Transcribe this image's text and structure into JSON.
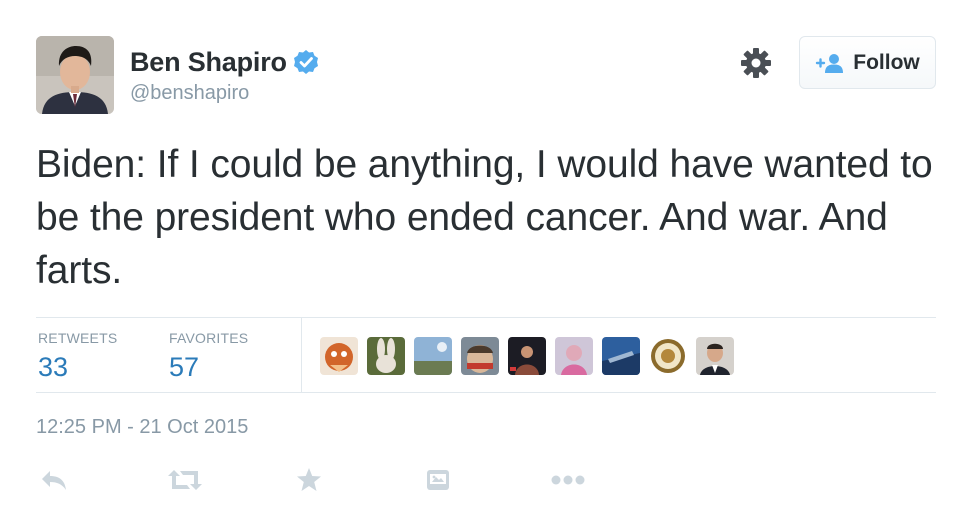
{
  "user": {
    "display_name": "Ben Shapiro",
    "handle": "@benshapiro",
    "verified": true
  },
  "header": {
    "follow_label": "Follow"
  },
  "tweet": {
    "text": "Biden: If I could be anything, I would have wanted to be the president who ended cancer. And war. And farts.",
    "timestamp": "12:25 PM - 21 Oct 2015"
  },
  "stats": {
    "retweets_label": "RETWEETS",
    "retweets_value": "33",
    "favorites_label": "FAVORITES",
    "favorites_value": "57"
  },
  "colors": {
    "text": "#292f33",
    "muted": "#8899a6",
    "link_blue": "#2b7bb9",
    "verified_blue": "#55acee",
    "border": "#e1e8ed",
    "icon_gray": "#ccd6dd"
  },
  "actions": [
    "reply-icon",
    "retweet-icon",
    "favorite-icon",
    "embed-media-icon",
    "more-icon"
  ]
}
